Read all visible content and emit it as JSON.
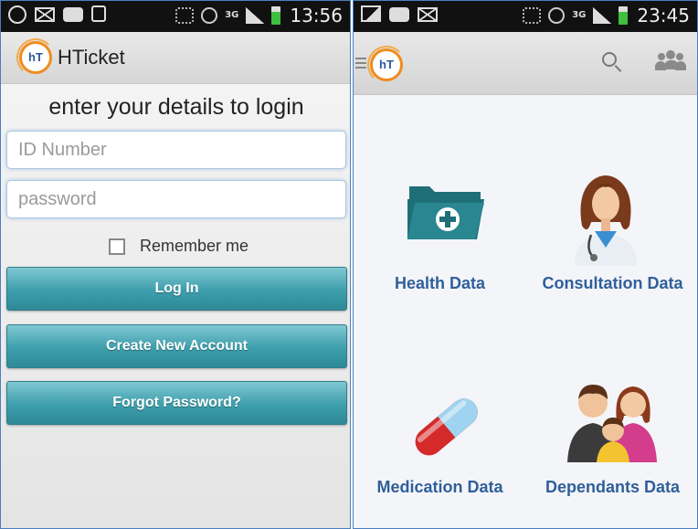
{
  "left_screen": {
    "status_bar": {
      "time": "13:56",
      "network": "3G",
      "icons": [
        "whatsapp-icon",
        "mail-icon",
        "bbm-icon",
        "lock-icon",
        "mute-icon",
        "alarm-icon",
        "signal-icon",
        "battery-icon"
      ]
    },
    "action_bar": {
      "logo_text": "hT",
      "title": "HTicket"
    },
    "login": {
      "heading": "enter your details to login",
      "id_placeholder": "ID Number",
      "password_placeholder": "password",
      "remember_label": "Remember me",
      "remember_checked": false,
      "login_button": "Log In",
      "create_account_button": "Create New Account",
      "forgot_password_button": "Forgot Password?"
    }
  },
  "right_screen": {
    "status_bar": {
      "time": "23:45",
      "network": "3G",
      "icons": [
        "image-icon",
        "bbm-icon",
        "mail-icon",
        "mute-icon",
        "alarm-icon",
        "signal-icon",
        "battery-icon"
      ]
    },
    "action_bar": {
      "logo_text": "hT",
      "icons": [
        "menu-icon",
        "search-icon",
        "people-icon"
      ]
    },
    "menu": [
      {
        "label": "Health Data",
        "icon": "folder-plus-icon"
      },
      {
        "label": "Consultation Data",
        "icon": "doctor-icon"
      },
      {
        "label": "Medication Data",
        "icon": "pill-icon"
      },
      {
        "label": "Dependants Data",
        "icon": "family-icon"
      }
    ]
  },
  "colors": {
    "button_teal": "#3d9eac",
    "label_blue": "#2f5f9a",
    "logo_orange": "#f08c1e",
    "folder_teal": "#1f6f78",
    "pill_red": "#d42a2a",
    "pill_blue": "#9fd3ef"
  }
}
